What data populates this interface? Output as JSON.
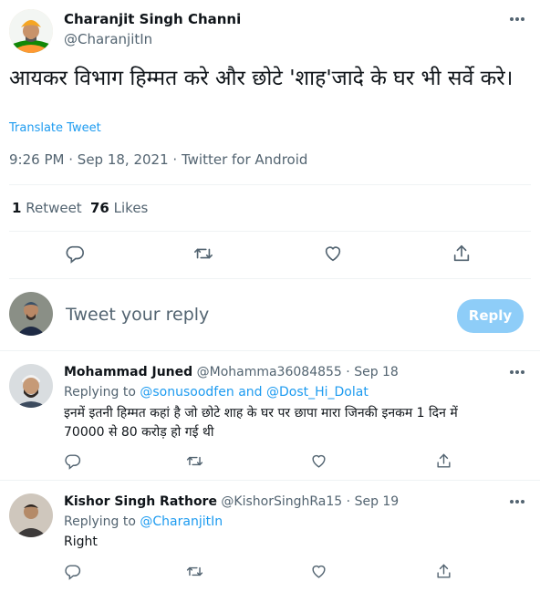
{
  "main_tweet": {
    "author_name": "Charanjit Singh Channi",
    "author_handle": "@CharanjitIn",
    "text": "आयकर विभाग हिम्मत करे और छोटे 'शाह'जादे के घर भी सर्वे करे।",
    "translate_label": "Translate Tweet",
    "time": "9:26 PM",
    "date": "Sep 18, 2021",
    "source": "Twitter for Android",
    "retweets_count": "1",
    "retweets_label": "Retweet",
    "likes_count": "76",
    "likes_label": "Likes"
  },
  "compose": {
    "placeholder": "Tweet your reply",
    "reply_button": "Reply"
  },
  "replies": [
    {
      "author_name": "Mohammad Juned",
      "author_handle": "@Mohamma36084855",
      "date": "Sep 18",
      "replying_label": "Replying to",
      "replying_to_1": "@sonusoodfen",
      "replying_and": "and",
      "replying_to_2": "@Dost_Hi_Dolat",
      "text_line1": "इनमें इतनी हिम्मत कहां है जो छोटे शाह के घर पर छापा मारा जिनकी इनकम 1 दिन में",
      "text_line2": "70000 से 80 करोड़ हो गई थी"
    },
    {
      "author_name": "Kishor Singh Rathore",
      "author_handle": "@KishorSinghRa15",
      "date": "Sep 19",
      "replying_label": "Replying to",
      "replying_to_1": "@CharanjitIn",
      "text_line1": "Right"
    }
  ],
  "colors": {
    "accent": "#1d9bf0",
    "text": "#0f1419",
    "secondary": "#536471",
    "divider": "#eff3f4",
    "reply_button_disabled": "#8ecdf8"
  },
  "separator": "·"
}
